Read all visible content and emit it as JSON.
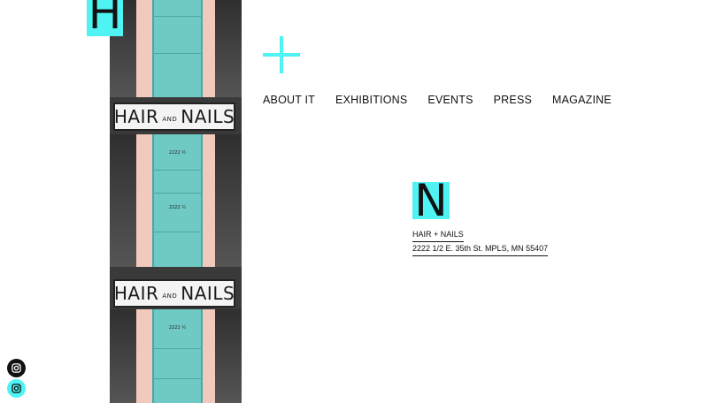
{
  "brand": {
    "logo_letter_top": "H",
    "logo_letter_block": "N",
    "accent_color": "#4ff3f3"
  },
  "nav": {
    "items": [
      {
        "label": "ABOUT IT"
      },
      {
        "label": "EXHIBITIONS"
      },
      {
        "label": "EVENTS"
      },
      {
        "label": "PRESS"
      },
      {
        "label": "MAGAZINE"
      }
    ]
  },
  "address": {
    "name": "HAIR + NAILS",
    "street": "2222 1/2 E. 35th St. MPLS, MN 55407"
  },
  "photo": {
    "sign_left": "HAIR",
    "sign_small": "AND",
    "sign_right": "NAILS",
    "door_number": "2222 ½"
  },
  "social": {
    "icon_1": "instagram-icon",
    "icon_2": "instagram-icon"
  }
}
